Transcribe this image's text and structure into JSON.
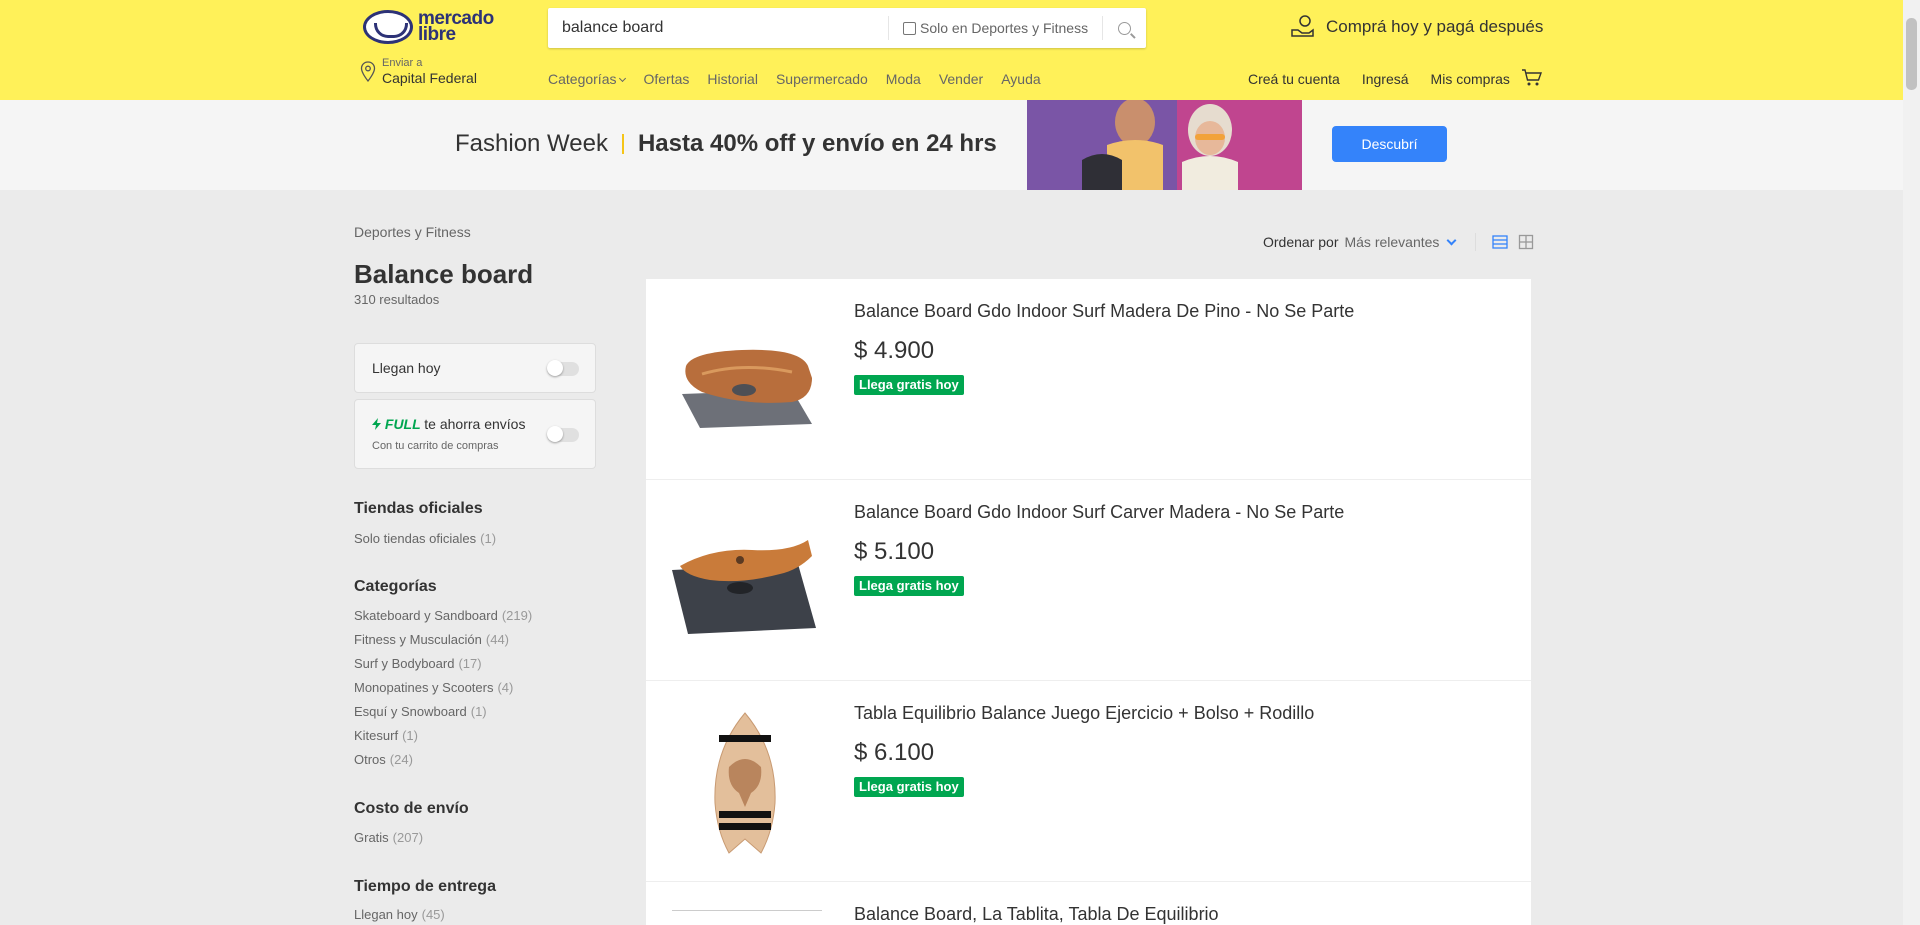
{
  "header": {
    "logo_line1": "mercado",
    "logo_line2": "libre",
    "search_value": "balance board",
    "search_filter_label": "Solo en Deportes y Fitness",
    "promo": "Comprá hoy y pagá después",
    "location_label": "Enviar a",
    "location_value": "Capital Federal",
    "nav": [
      "Categorías",
      "Ofertas",
      "Historial",
      "Supermercado",
      "Moda",
      "Vender",
      "Ayuda"
    ],
    "user_nav": [
      "Creá tu cuenta",
      "Ingresá",
      "Mis compras"
    ]
  },
  "banner": {
    "title": "Fashion Week",
    "headline": "Hasta 40% off y envío en 24 hrs",
    "button": "Descubrí"
  },
  "sidebar": {
    "breadcrumb": "Deportes y Fitness",
    "title": "Balance board",
    "results": "310 resultados",
    "filter_today": "Llegan hoy",
    "full_brand": "FULL",
    "full_text": " te ahorra envíos",
    "full_note": "Con tu carrito de compras",
    "official_title": "Tiendas oficiales",
    "official_items": [
      {
        "label": "Solo tiendas oficiales",
        "count": "(1)"
      }
    ],
    "categories_title": "Categorías",
    "categories": [
      {
        "label": "Skateboard y Sandboard",
        "count": "(219)"
      },
      {
        "label": "Fitness y Musculación",
        "count": "(44)"
      },
      {
        "label": "Surf y Bodyboard",
        "count": "(17)"
      },
      {
        "label": "Monopatines y Scooters",
        "count": "(4)"
      },
      {
        "label": "Esquí y Snowboard",
        "count": "(1)"
      },
      {
        "label": "Kitesurf",
        "count": "(1)"
      },
      {
        "label": "Otros",
        "count": "(24)"
      }
    ],
    "shipping_title": "Costo de envío",
    "shipping_items": [
      {
        "label": "Gratis",
        "count": "(207)"
      }
    ],
    "delivery_title": "Tiempo de entrega",
    "delivery_items": [
      {
        "label": "Llegan hoy",
        "count": "(45)"
      }
    ]
  },
  "sort": {
    "label": "Ordenar por",
    "value": "Más relevantes"
  },
  "items": [
    {
      "title": "Balance Board Gdo Indoor Surf Madera De Pino - No Se Parte",
      "price": "$ 4.900",
      "badge": "Llega gratis hoy"
    },
    {
      "title": "Balance Board Gdo Indoor Surf Carver Madera - No Se Parte",
      "price": "$ 5.100",
      "badge": "Llega gratis hoy"
    },
    {
      "title": "Tabla Equilibrio Balance Juego Ejercicio + Bolso + Rodillo",
      "price": "$ 6.100",
      "badge": "Llega gratis hoy"
    },
    {
      "title": "Balance Board, La Tablita, Tabla De Equilibrio",
      "price": "",
      "badge": ""
    }
  ],
  "colors": {
    "header": "#fff159",
    "accent": "#3483fa",
    "free_shipping": "#00a650",
    "brand_blue": "#2d3277"
  }
}
